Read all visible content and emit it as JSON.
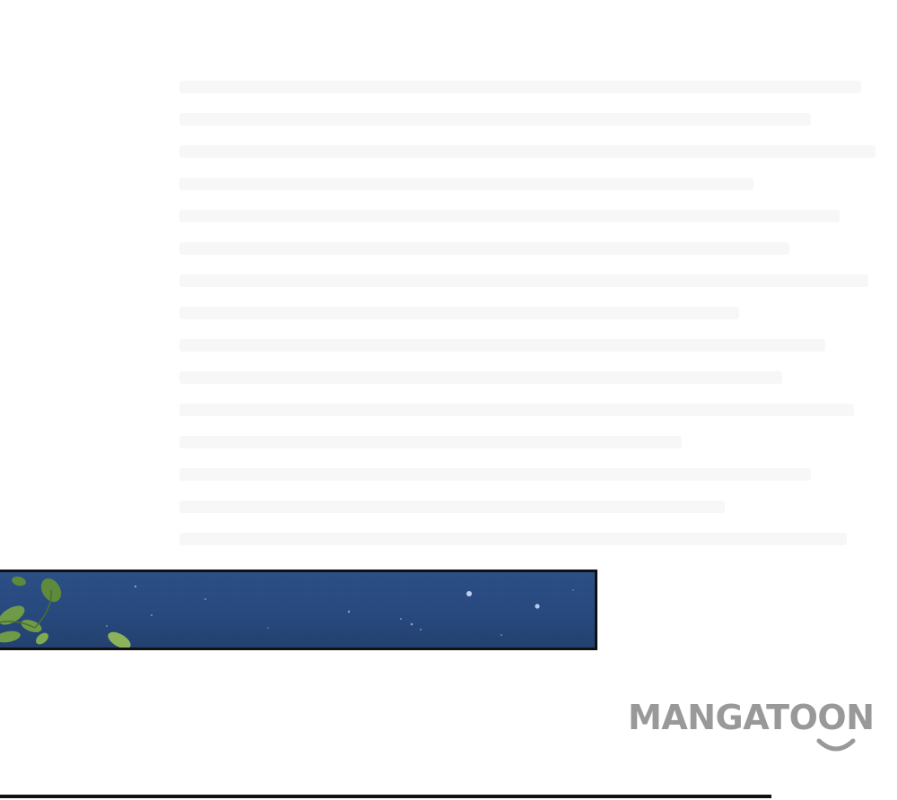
{
  "watermark": {
    "text": "MANGATOON",
    "color": "#999999"
  },
  "panel": {
    "sky_color": "#28497e",
    "border_color": "#111111",
    "leaf_color": "#6f9a48"
  }
}
